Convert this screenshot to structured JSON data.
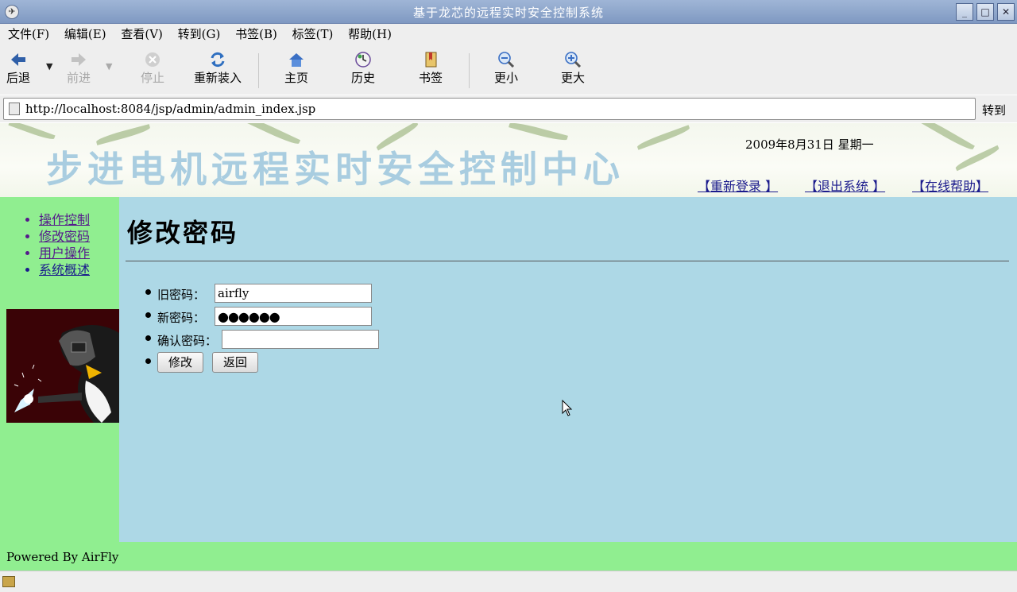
{
  "window": {
    "title": "基于龙芯的远程实时安全控制系统",
    "controls": [
      "_",
      "□",
      "✕"
    ]
  },
  "menu": [
    "文件(F)",
    "编辑(E)",
    "查看(V)",
    "转到(G)",
    "书签(B)",
    "标签(T)",
    "帮助(H)"
  ],
  "toolbar": {
    "back": "后退",
    "forward": "前进",
    "stop": "停止",
    "reload": "重新装入",
    "home": "主页",
    "history": "历史",
    "bookmarks": "书签",
    "zoom_out": "更小",
    "zoom_in": "更大"
  },
  "address": {
    "url": "http://localhost:8084/jsp/admin/admin_index.jsp",
    "go": "转到"
  },
  "banner": {
    "title": "步进电机远程实时安全控制中心",
    "date": "2009年8月31日 星期一",
    "links": [
      "【重新登录 】",
      "【退出系统 】",
      "【在线帮助】"
    ]
  },
  "sidebar": {
    "items": [
      "操作控制",
      "修改密码",
      "用户操作",
      "系统概述"
    ]
  },
  "main": {
    "heading": "修改密码",
    "form": {
      "old_label": "旧密码：",
      "old_value": "airfly",
      "new_label": "新密码：",
      "new_value": "●●●●●●",
      "confirm_label": "确认密码：",
      "confirm_value": "",
      "submit": "修改",
      "back": "返回"
    }
  },
  "footer": "Powered By AirFly",
  "colors": {
    "sidebar": "#90ee90",
    "content": "#add8e6",
    "banner_title": "#a9cde0",
    "link": "#551a8b"
  }
}
